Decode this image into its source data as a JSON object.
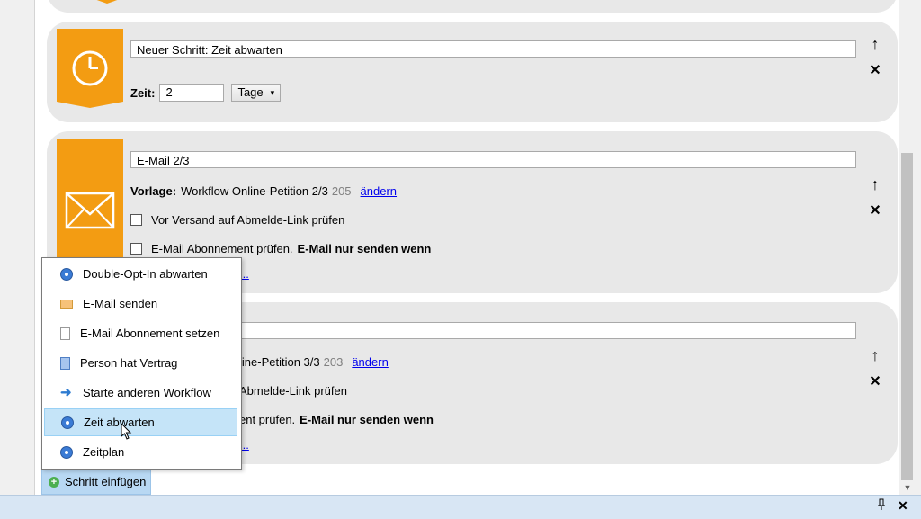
{
  "steps": {
    "wait": {
      "title": "Neuer Schritt: Zeit abwarten",
      "time_label": "Zeit:",
      "time_value": "2",
      "unit": "Tage"
    },
    "email2": {
      "title": "E-Mail 2/3",
      "template_label": "Vorlage:",
      "template_name": "Workflow Online-Petition 2/3",
      "template_id": "205",
      "change_link": "ändern",
      "check1": "Vor Versand auf Abmelde-Link prüfen",
      "check2_prefix": "E-Mail Abonnement prüfen.",
      "check2_bold": "E-Mail nur senden wenn",
      "partial_link": "..."
    },
    "email3": {
      "template_partial": "line-Petition 3/3",
      "template_id": "203",
      "change_link": "ändern",
      "check1_partial": "Abmelde-Link prüfen",
      "check2_partial_prefix": "ent prüfen.",
      "check2_bold": "E-Mail nur senden wenn",
      "partial_link": "..."
    }
  },
  "icons": {
    "up": "↑",
    "close": "✕",
    "pin": "pin-icon",
    "cursor": "mouse-pointer"
  },
  "menu": {
    "items": [
      {
        "label": "Double-Opt-In abwarten",
        "icon": "clock-icon"
      },
      {
        "label": "E-Mail senden",
        "icon": "mail-icon"
      },
      {
        "label": "E-Mail Abonnement setzen",
        "icon": "document-icon"
      },
      {
        "label": "Person hat Vertrag",
        "icon": "contract-icon"
      },
      {
        "label": "Starte anderen Workflow",
        "icon": "arrow-right-icon"
      },
      {
        "label": "Zeit abwarten",
        "icon": "clock-icon"
      },
      {
        "label": "Zeitplan",
        "icon": "clock-icon"
      }
    ],
    "highlighted_index": 5
  },
  "insert_button": "Schritt einfügen",
  "colors": {
    "accent_orange": "#f39c12",
    "link_blue": "#0000ee",
    "highlight": "#c5e4f8",
    "card_bg": "#e8e8e8"
  }
}
